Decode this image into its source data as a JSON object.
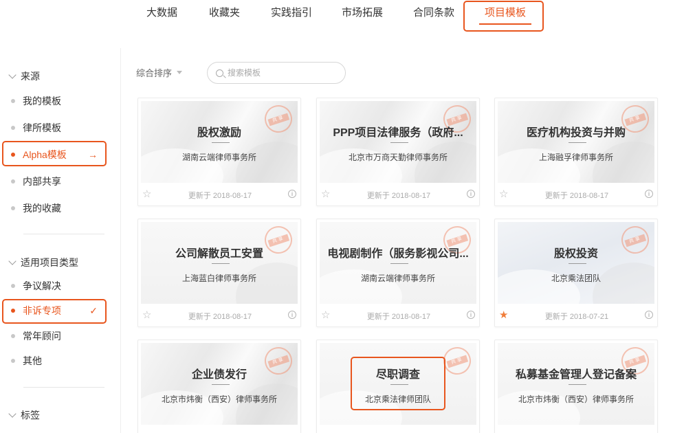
{
  "nav": {
    "tabs": [
      {
        "label": "大数据"
      },
      {
        "label": "收藏夹"
      },
      {
        "label": "实践指引"
      },
      {
        "label": "市场拓展"
      },
      {
        "label": "合同条款"
      },
      {
        "label": "项目模板",
        "active": true
      }
    ]
  },
  "sidebar": {
    "source": {
      "title": "来源",
      "items": [
        {
          "label": "我的模板"
        },
        {
          "label": "律所模板"
        },
        {
          "label": "Alpha模板",
          "active": true,
          "trail": "→"
        },
        {
          "label": "内部共享"
        },
        {
          "label": "我的收藏"
        }
      ]
    },
    "types": {
      "title": "适用项目类型",
      "items": [
        {
          "label": "争议解决"
        },
        {
          "label": "非诉专项",
          "active": true,
          "trail": "✓"
        },
        {
          "label": "常年顾问"
        },
        {
          "label": "其他"
        }
      ]
    },
    "tags": {
      "title": "标签"
    }
  },
  "toolbar": {
    "sort_label": "综合排序",
    "search_placeholder": "搜索模板"
  },
  "stamp_text": "共享",
  "cards": [
    {
      "title": "股权激励",
      "firm": "湖南云端律师事务所",
      "updated": "更新于 2018-08-17",
      "starred": false
    },
    {
      "title": "PPP项目法律服务（政府...",
      "firm": "北京市万商天勤律师事务所",
      "updated": "更新于 2018-08-17",
      "starred": false
    },
    {
      "title": "医疗机构投资与并购",
      "firm": "上海融孚律师事务所",
      "updated": "更新于 2018-08-17",
      "starred": false
    },
    {
      "title": "公司解散员工安置",
      "firm": "上海蓝白律师事务所",
      "updated": "更新于 2018-08-17",
      "starred": false
    },
    {
      "title": "电视剧制作（服务影视公司...",
      "firm": "湖南云端律师事务所",
      "updated": "更新于 2018-08-17",
      "starred": false
    },
    {
      "title": "股权投资",
      "firm": "北京乘法团队",
      "updated": "更新于 2018-07-21",
      "starred": true
    },
    {
      "title": "企业债发行",
      "firm": "北京市炜衡（西安）律师事务所",
      "updated": "",
      "starred": false
    },
    {
      "title": "尽职调查",
      "firm": "北京乘法律师团队",
      "updated": "",
      "starred": false
    },
    {
      "title": "私募基金管理人登记备案",
      "firm": "北京市炜衡（西安）律师事务所",
      "updated": "",
      "starred": false
    }
  ],
  "colors": {
    "accent": "#e8551d",
    "star_on": "#f07d3a"
  },
  "icons": [
    "chevron-down-icon",
    "search-icon",
    "arrow-right-icon",
    "check-icon",
    "star-icon",
    "info-icon",
    "share-stamp-icon"
  ]
}
